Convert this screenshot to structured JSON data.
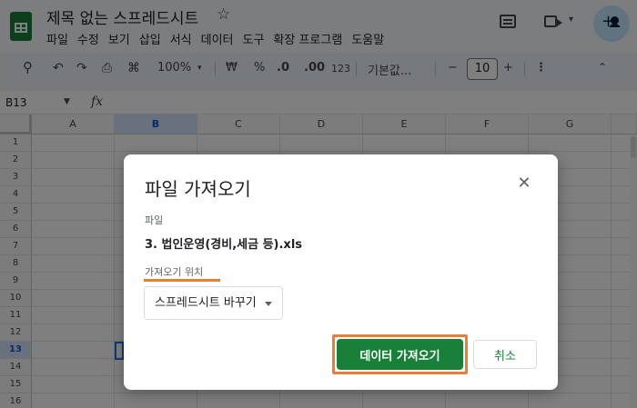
{
  "header": {
    "title": "제목 없는 스프레드시트",
    "menu": [
      "파일",
      "수정",
      "보기",
      "삽입",
      "서식",
      "데이터",
      "도구",
      "확장 프로그램",
      "도움말"
    ],
    "icons": [
      "sheets-logo-icon",
      "star-icon",
      "comment-icon",
      "meet-icon",
      "share-icon"
    ]
  },
  "toolbar": {
    "zoom": "100%",
    "currency": "₩",
    "percent": "%",
    "decimal_decrease": ".0",
    "decimal_increase": ".00",
    "number_format": "123",
    "font": "기본값...",
    "font_size": "10",
    "minus": "−",
    "plus": "+"
  },
  "formula_bar": {
    "name_box": "B13",
    "fx": "fx"
  },
  "grid": {
    "columns": [
      "A",
      "B",
      "C",
      "D",
      "E",
      "F",
      "G"
    ],
    "rows": [
      "1",
      "2",
      "3",
      "4",
      "5",
      "6",
      "7",
      "8",
      "9",
      "10",
      "11",
      "12",
      "13",
      "14",
      "15",
      "16"
    ],
    "selected_column": "B",
    "selected_row": "13"
  },
  "dialog": {
    "title": "파일 가져오기",
    "file_label": "파일",
    "file_name": "3. 법인운영(경비,세금 등).xls",
    "location_label": "가져오기 위치",
    "location_value": "스프레드시트 바꾸기",
    "import_button": "데이터 가져오기",
    "cancel_button": "취소",
    "accent_color": "#188038",
    "highlight_color": "#ed7d31"
  }
}
